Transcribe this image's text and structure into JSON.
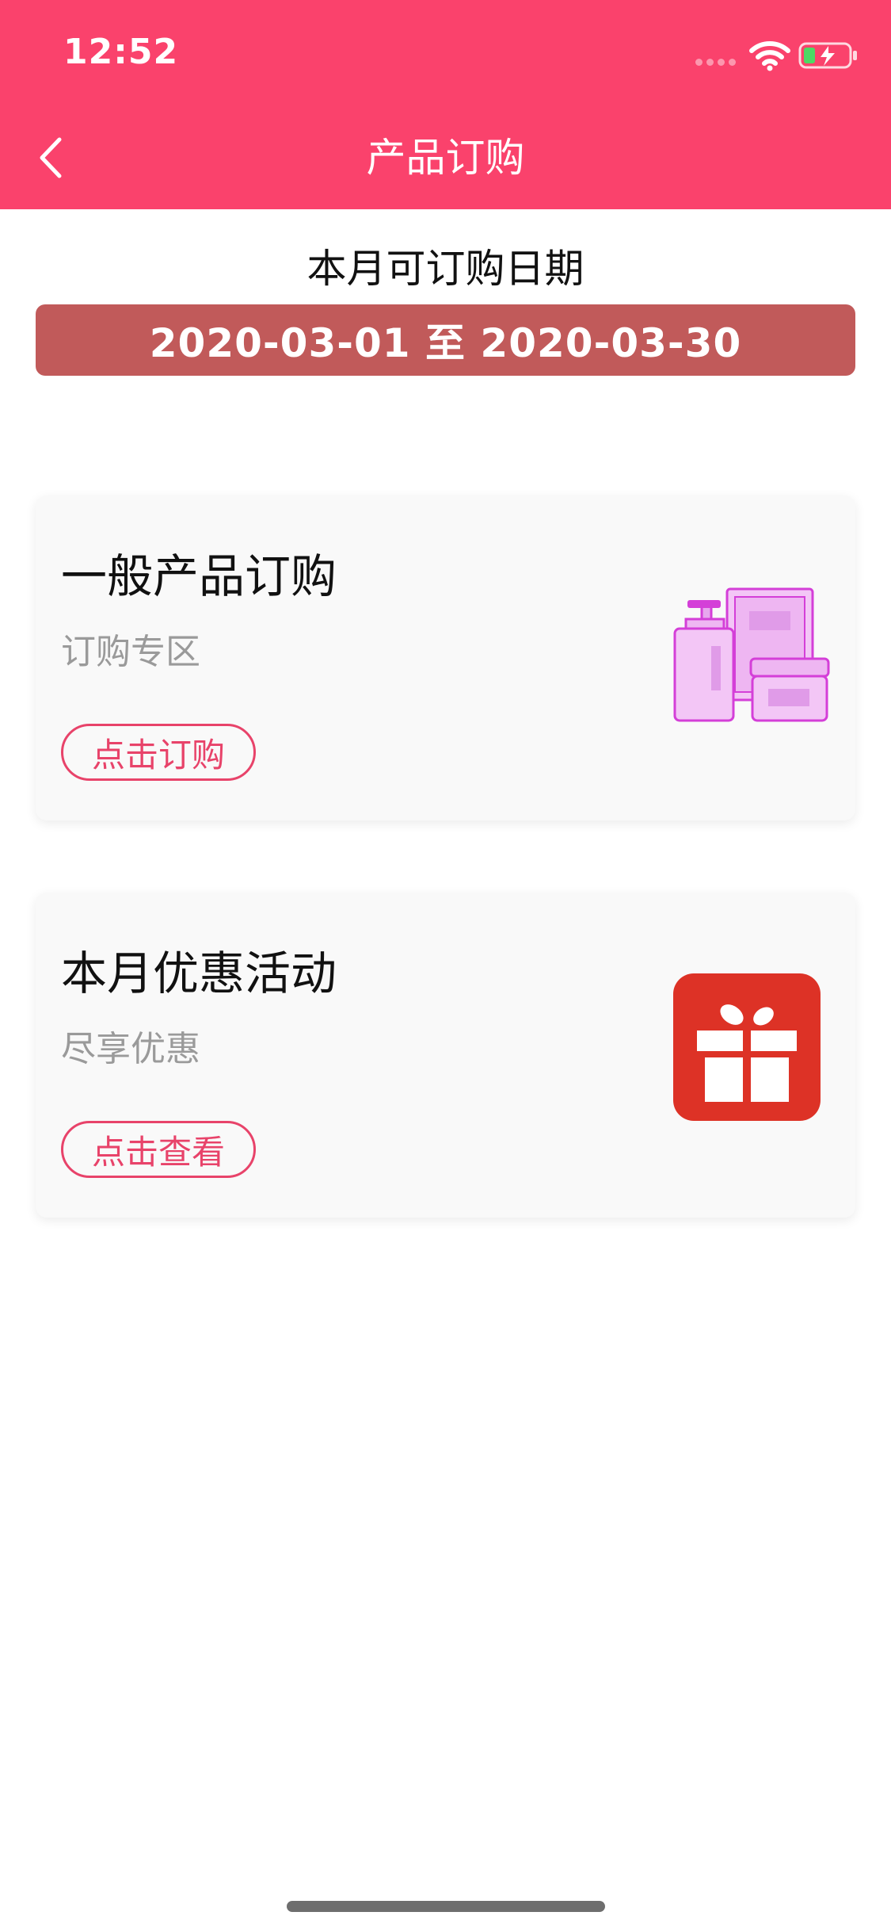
{
  "status_bar": {
    "time": "12:52"
  },
  "nav": {
    "title": "产品订购",
    "back_icon": "chevron-left-icon"
  },
  "date_section": {
    "label": "本月可订购日期",
    "range": "2020-03-01 至 2020-03-30"
  },
  "cards": [
    {
      "title": "一般产品订购",
      "subtitle": "订购专区",
      "button": "点击订购",
      "icon": "cosmetics-products-icon"
    },
    {
      "title": "本月优惠活动",
      "subtitle": "尽享优惠",
      "button": "点击查看",
      "icon": "gift-icon"
    }
  ],
  "colors": {
    "header": "#FA426C",
    "date_banner": "#C15A5A",
    "accent": "#E8436A",
    "gift": "#DD3226",
    "product_icon": "#D43FD8"
  }
}
